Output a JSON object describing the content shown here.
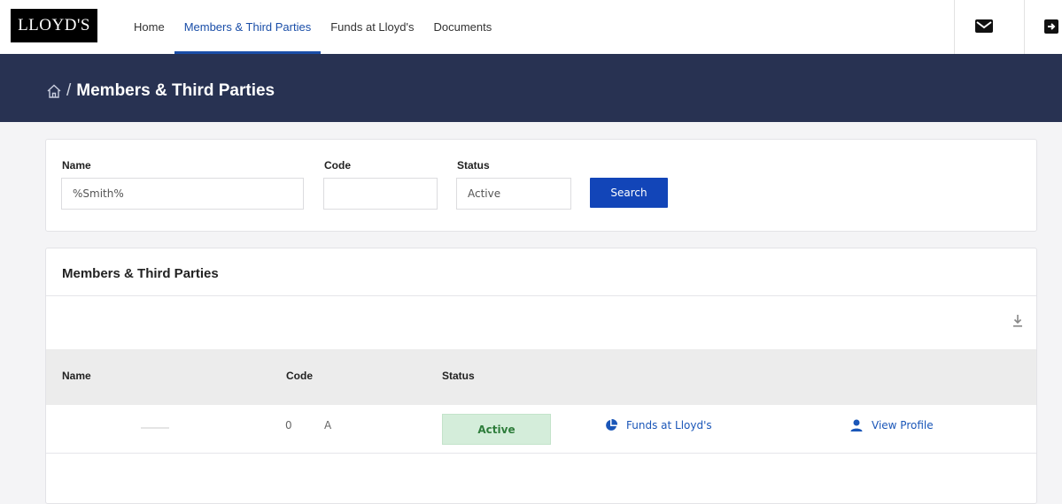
{
  "brand": {
    "logo_text": "LLOYD'S"
  },
  "nav": {
    "items": [
      {
        "label": "Home",
        "active": false
      },
      {
        "label": "Members & Third Parties",
        "active": true
      },
      {
        "label": "Funds at Lloyd's",
        "active": false
      },
      {
        "label": "Documents",
        "active": false
      }
    ],
    "icons": [
      "mail-icon",
      "logout-icon"
    ]
  },
  "header": {
    "breadcrumb_title": "Members & Third Parties",
    "separator": "/"
  },
  "filters": {
    "name": {
      "label": "Name",
      "value": "%Smith%"
    },
    "code": {
      "label": "Code",
      "value": ""
    },
    "status": {
      "label": "Status",
      "value": "Active"
    },
    "search_label": "Search"
  },
  "results": {
    "title": "Members & Third Parties",
    "columns": [
      "Name",
      "Code",
      "Status"
    ],
    "rows": [
      {
        "name": "",
        "code": "0",
        "code_suffix": "A",
        "status": "Active",
        "funds_link": "Funds at Lloyd's",
        "profile_link": "View Profile"
      }
    ]
  },
  "colors": {
    "accent": "#1245b8",
    "header_band": "#283252",
    "active_badge_bg": "#d4edda",
    "active_badge_text": "#2e7d3b",
    "link": "#1a56b8"
  }
}
